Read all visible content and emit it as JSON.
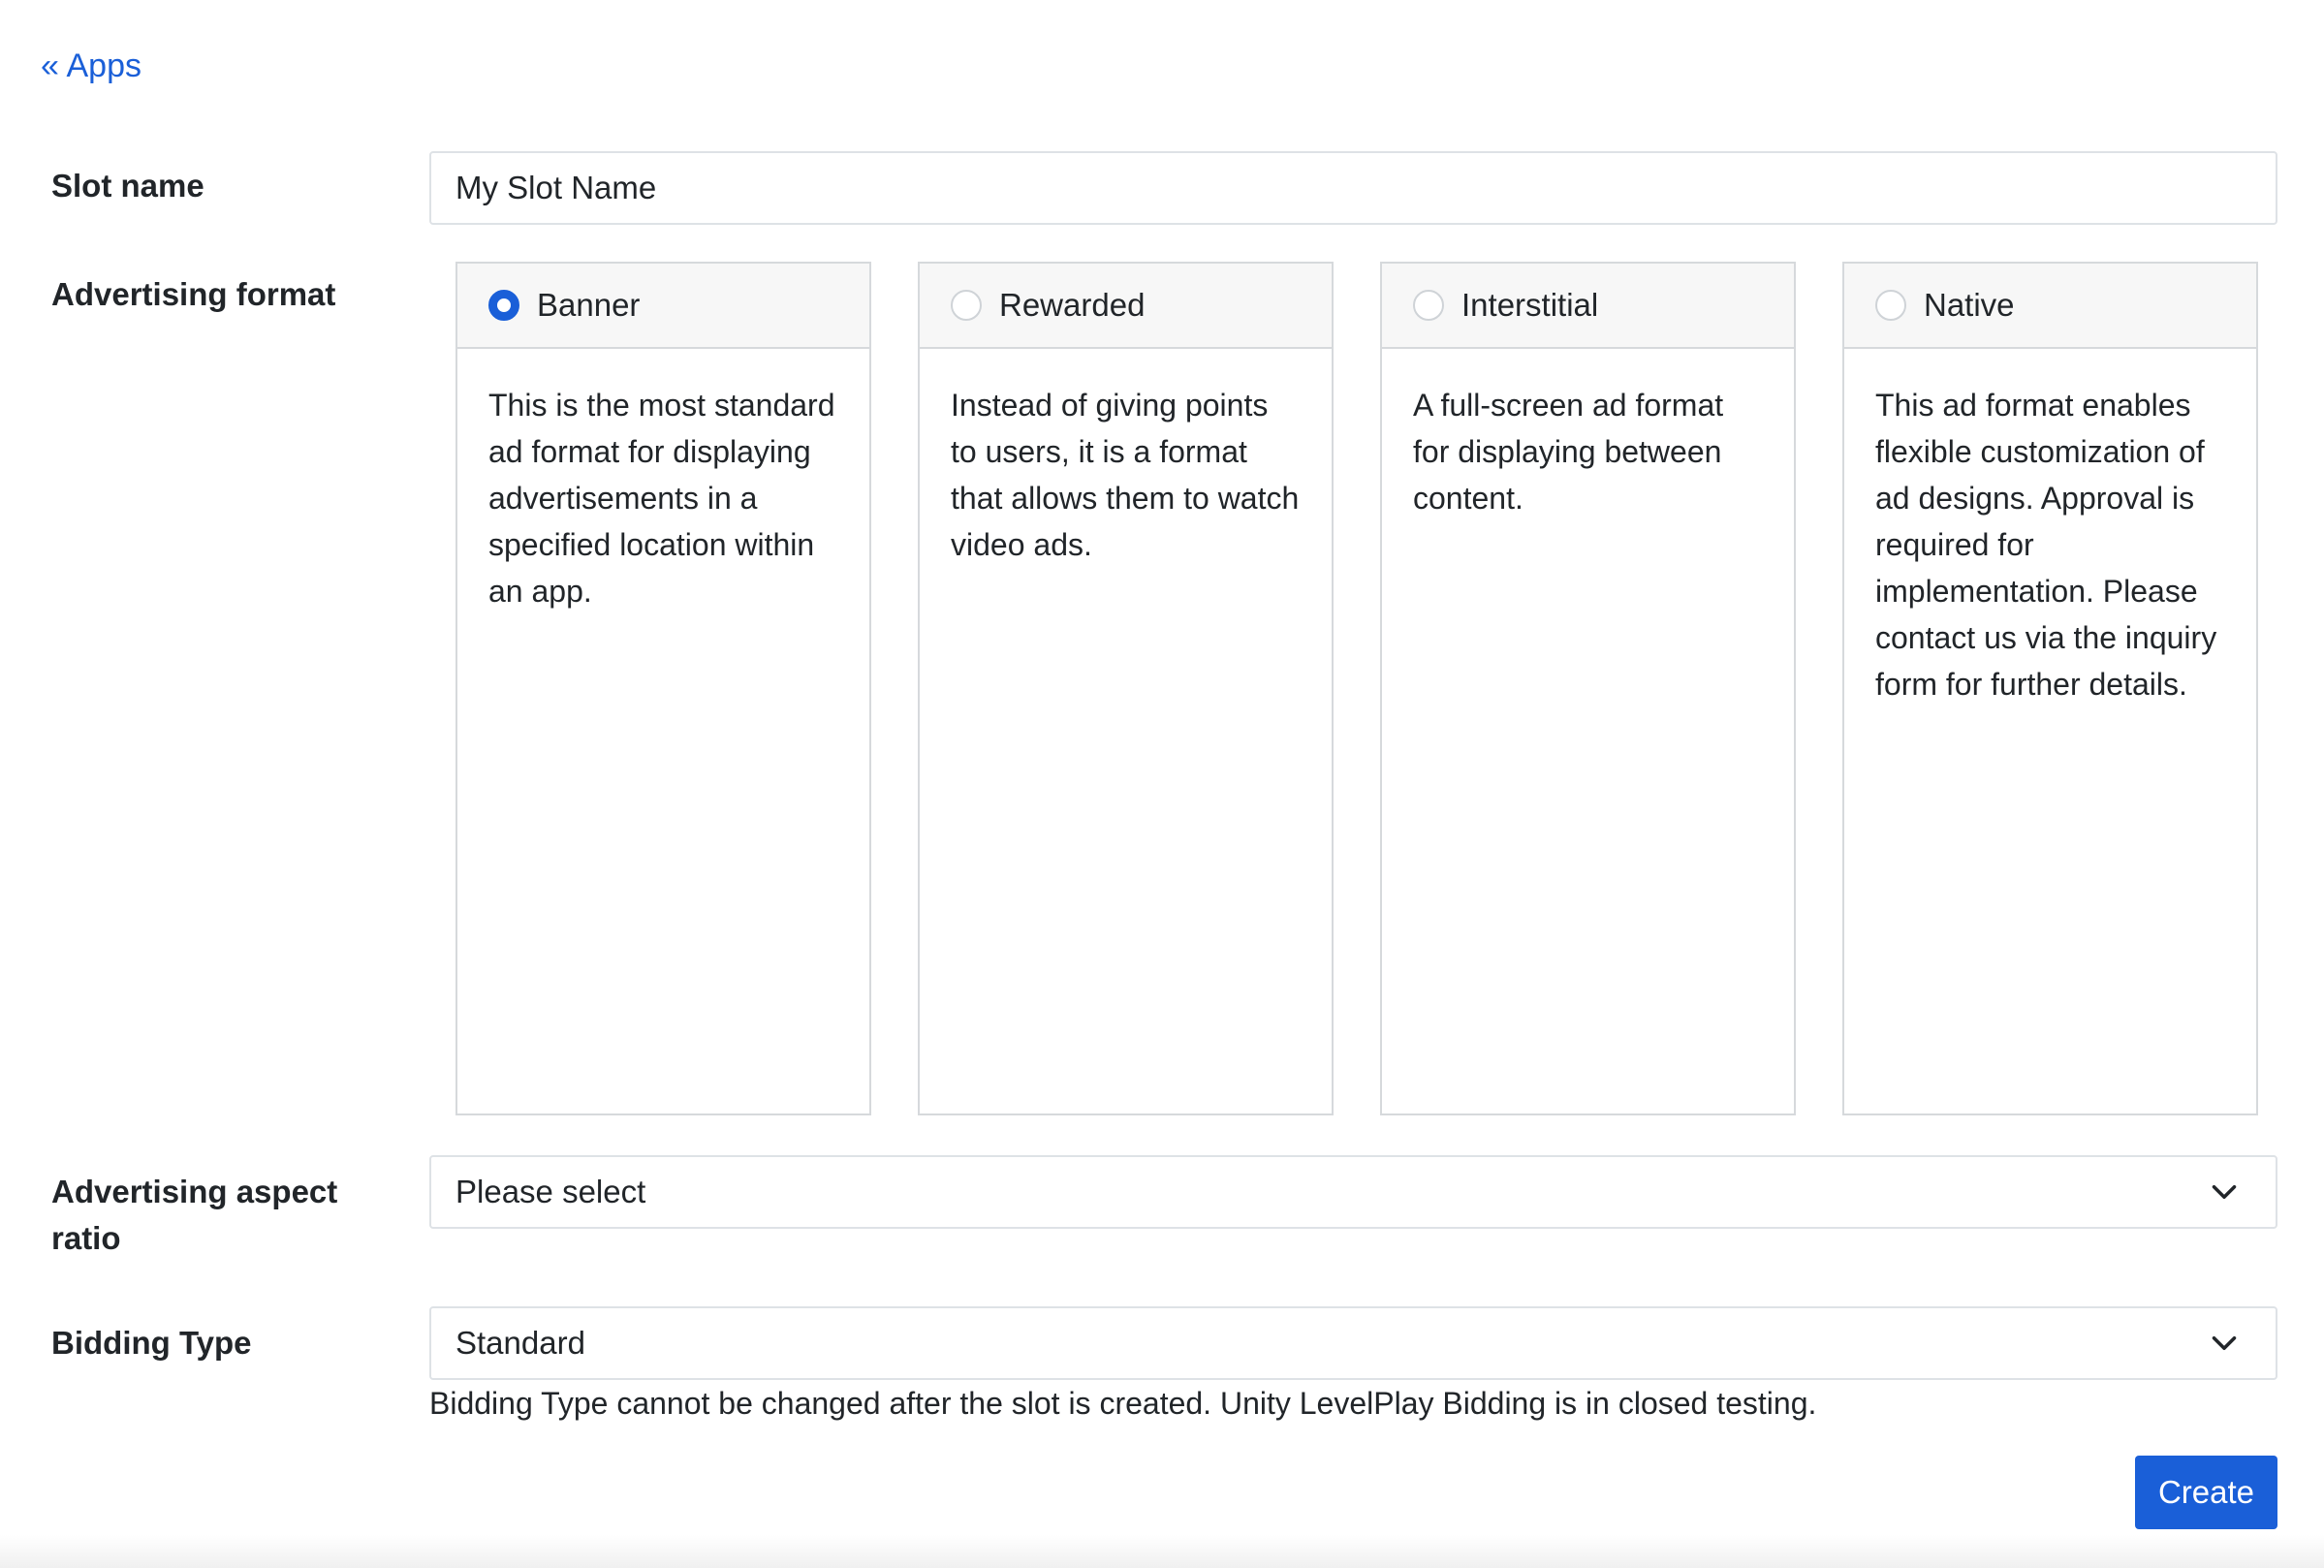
{
  "nav": {
    "back_label": "« Apps"
  },
  "slot_name": {
    "label": "Slot name",
    "value": "My Slot Name"
  },
  "advertising_format": {
    "label": "Advertising format",
    "options": [
      {
        "title": "Banner",
        "selected": true,
        "description": "This is the most standard ad format for displaying advertisements in a specified location within an app."
      },
      {
        "title": "Rewarded",
        "selected": false,
        "description": "Instead of giving points to users, it is a format that allows them to watch video ads."
      },
      {
        "title": "Interstitial",
        "selected": false,
        "description": "A full-screen ad format for displaying between content."
      },
      {
        "title": "Native",
        "selected": false,
        "description": "This ad format enables flexible customization of ad designs. Approval is required for implementation. Please contact us via the inquiry form for further details."
      }
    ]
  },
  "aspect_ratio": {
    "label": "Advertising aspect ratio",
    "value": "Please select"
  },
  "bidding_type": {
    "label": "Bidding Type",
    "value": "Standard",
    "hint": "Bidding Type cannot be changed after the slot is created. Unity LevelPlay Bidding is in closed testing."
  },
  "actions": {
    "create_label": "Create"
  },
  "colors": {
    "accent": "#1a5fd8",
    "border": "#dee2e6",
    "card_header": "#f7f7f7"
  },
  "icons": {
    "select_arrow": "chevron-down-icon",
    "radio": "radio-icon"
  }
}
